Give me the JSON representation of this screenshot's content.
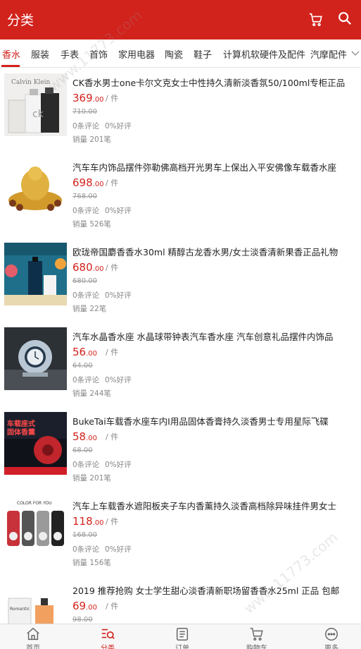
{
  "header": {
    "title": "分类",
    "cart_icon": "cart-icon",
    "search_icon": "search-icon"
  },
  "tabs": [
    {
      "label": "香水",
      "active": true
    },
    {
      "label": "服装"
    },
    {
      "label": "手表"
    },
    {
      "label": "首饰"
    },
    {
      "label": "家用电器"
    },
    {
      "label": "陶瓷"
    },
    {
      "label": "鞋子"
    },
    {
      "label": "计算机软硬件及配件"
    },
    {
      "label": "汽摩配件"
    }
  ],
  "products": [
    {
      "name": "CK香水男士one卡尔文克女士中性持久清新淡香氛50/100ml专柜正品",
      "price_int": "369",
      "price_dec": ".00",
      "unit": "/ 件",
      "orig": "710.00",
      "reviews": "0条评论",
      "good": "0%好评",
      "sales": "销量 201笔",
      "thumb_text": "Calvin Klein"
    },
    {
      "name": "汽车车内饰品摆件弥勒佛高档开光男车上保出入平安佛像车载香水座",
      "price_int": "698",
      "price_dec": ".00",
      "unit": "/ 件",
      "orig": "768.00",
      "reviews": "0条评论",
      "good": "0%好评",
      "sales": "销量 526笔"
    },
    {
      "name": "欧珑帝国麝香香水30ml 精醇古龙香水男/女士淡香清新果香正品礼物",
      "price_int": "680",
      "price_dec": ".00",
      "unit": "/ 件",
      "orig": "680.00",
      "reviews": "0条评论",
      "good": "0%好评",
      "sales": "销量 22笔"
    },
    {
      "name": "汽车水晶香水座 水晶球带钟表汽车香水座 汽车创意礼品摆件内饰品",
      "price_int": "56",
      "price_dec": ".00",
      "unit": "/ 件",
      "orig": "64.00",
      "reviews": "0条评论",
      "good": "0%好评",
      "sales": "销量 244笔"
    },
    {
      "name": "BukeTai车载香水座车内I用品固体香膏持久淡香男士专用星际飞碟",
      "price_int": "58",
      "price_dec": ".00",
      "unit": "/ 件",
      "orig": "68.00",
      "reviews": "0条评论",
      "good": "0%好评",
      "sales": "销量 201笔",
      "thumb_text": "车载座式 固体香薰"
    },
    {
      "name": "汽车上车载香水遮阳板夹子车内香薰持久淡香高档除异味挂件男女士",
      "price_int": "118",
      "price_dec": ".00",
      "unit": "/ 件",
      "orig": "168.00",
      "reviews": "0条评论",
      "good": "0%好评",
      "sales": "销量 156笔",
      "thumb_text": "COLOR FOR YOU"
    },
    {
      "name": "2019 推荐抢购 女士学生甜心淡香清新职场留香香水25ml 正品 包邮",
      "price_int": "69",
      "price_dec": ".00",
      "unit": "/ 件",
      "orig": "98.00",
      "reviews": "",
      "good": "",
      "sales": "",
      "thumb_text": "Romantic"
    }
  ],
  "bottom_nav": [
    {
      "label": "首页",
      "icon": "home-icon"
    },
    {
      "label": "分类",
      "icon": "category-icon",
      "active": true
    },
    {
      "label": "订单",
      "icon": "order-icon"
    },
    {
      "label": "购物车",
      "icon": "cart-icon"
    },
    {
      "label": "更多",
      "icon": "more-icon"
    }
  ],
  "watermark": "www.11773.com",
  "colors": {
    "accent": "#d2221c"
  }
}
